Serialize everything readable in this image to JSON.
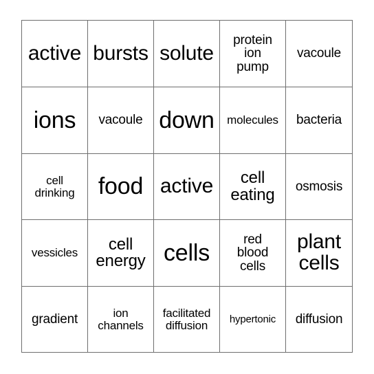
{
  "card": {
    "type": "bingo-card",
    "columns": 5,
    "rows": 5,
    "grid_line_color": "#6e6e6e",
    "background_color": "#ffffff",
    "text_color": "#000000",
    "cells": [
      [
        {
          "text": "active",
          "size": "lg"
        },
        {
          "text": "bursts",
          "size": "lg"
        },
        {
          "text": "solute",
          "size": "lg"
        },
        {
          "text": "protein\nion\npump",
          "size": "sm"
        },
        {
          "text": "vacoule",
          "size": "sm"
        }
      ],
      [
        {
          "text": "ions",
          "size": "xl"
        },
        {
          "text": "vacoule",
          "size": "sm"
        },
        {
          "text": "down",
          "size": "xl"
        },
        {
          "text": "molecules",
          "size": "xs"
        },
        {
          "text": "bacteria",
          "size": "sm"
        }
      ],
      [
        {
          "text": "cell\ndrinking",
          "size": "xs"
        },
        {
          "text": "food",
          "size": "xl"
        },
        {
          "text": "active",
          "size": "lg"
        },
        {
          "text": "cell\neating",
          "size": "md"
        },
        {
          "text": "osmosis",
          "size": "sm"
        }
      ],
      [
        {
          "text": "vessicles",
          "size": "xs"
        },
        {
          "text": "cell\nenergy",
          "size": "md"
        },
        {
          "text": "cells",
          "size": "xl"
        },
        {
          "text": "red\nblood\ncells",
          "size": "sm"
        },
        {
          "text": "plant\ncells",
          "size": "lg"
        }
      ],
      [
        {
          "text": "gradient",
          "size": "sm"
        },
        {
          "text": "ion\nchannels",
          "size": "xs"
        },
        {
          "text": "facilitated\ndiffusion",
          "size": "xs"
        },
        {
          "text": "hypertonic",
          "size": "xxs"
        },
        {
          "text": "diffusion",
          "size": "sm"
        }
      ]
    ]
  }
}
